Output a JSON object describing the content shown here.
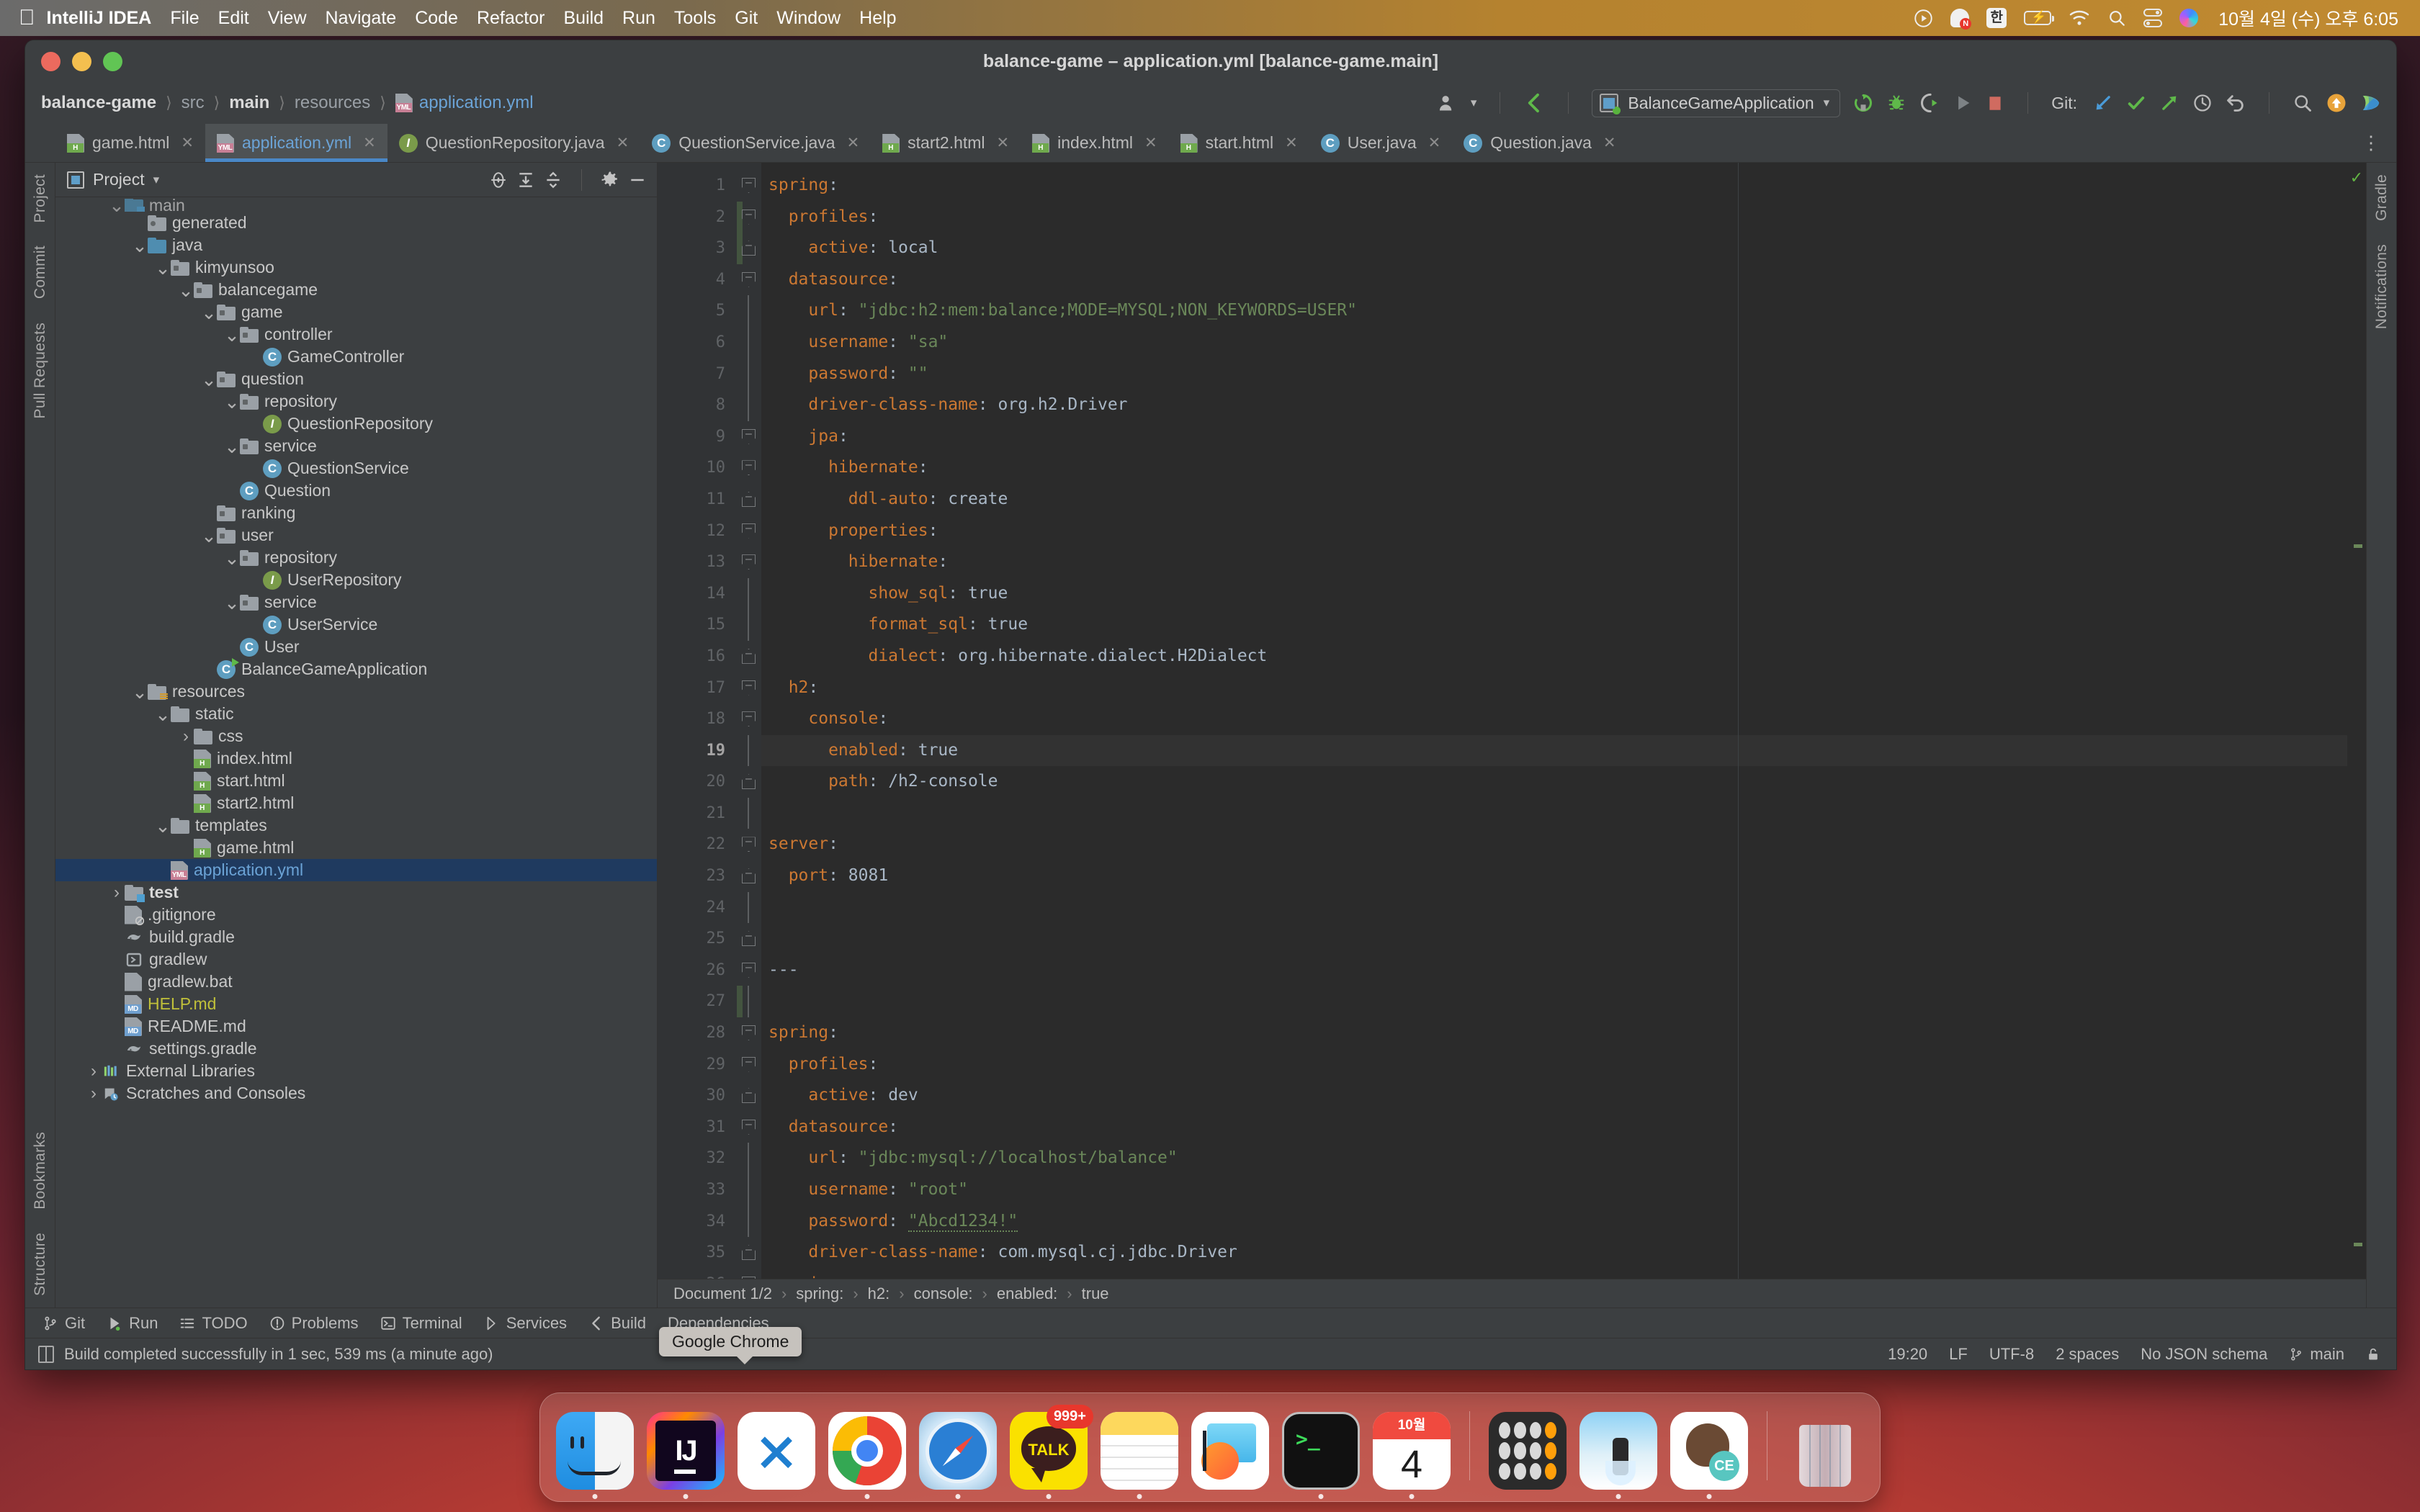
{
  "menubar": {
    "apple_icon": "apple-logo-icon",
    "items": [
      "IntelliJ IDEA",
      "File",
      "Edit",
      "View",
      "Navigate",
      "Code",
      "Refactor",
      "Build",
      "Run",
      "Tools",
      "Git",
      "Window",
      "Help"
    ],
    "tray": {
      "icons": [
        "play-circle-icon",
        "naver-whale-icon",
        "korean-input-icon",
        "battery-charging-icon",
        "wifi-icon",
        "search-icon",
        "control-center-icon",
        "siri-icon"
      ],
      "input_source": "한",
      "clock": "10월 4일 (수) 오후 6:05"
    }
  },
  "window": {
    "title": "balance-game – application.yml [balance-game.main]",
    "traffic_lights": [
      "close-button",
      "minimize-button",
      "zoom-button"
    ]
  },
  "toolbar": {
    "breadcrumb": [
      "balance-game",
      "src",
      "main",
      "resources",
      "application.yml"
    ],
    "run_config": "BalanceGameApplication",
    "git_label": "Git:",
    "icons": [
      "user-avatar-icon",
      "chevron-down-icon",
      "back-arrow-icon",
      "run-config-icon",
      "rerun-icon",
      "debug-icon",
      "coverage-icon",
      "run-icon",
      "stop-icon",
      "update-project-icon",
      "commit-icon",
      "push-icon",
      "history-icon",
      "rollback-icon",
      "search-everywhere-icon",
      "upload-icon",
      "whale-icon"
    ]
  },
  "tabs": [
    {
      "label": "game.html",
      "type": "html",
      "active": false
    },
    {
      "label": "application.yml",
      "type": "yml",
      "active": true
    },
    {
      "label": "QuestionRepository.java",
      "type": "interface",
      "active": false
    },
    {
      "label": "QuestionService.java",
      "type": "class",
      "active": false
    },
    {
      "label": "start2.html",
      "type": "html",
      "active": false
    },
    {
      "label": "index.html",
      "type": "html",
      "active": false
    },
    {
      "label": "start.html",
      "type": "html",
      "active": false
    },
    {
      "label": "User.java",
      "type": "class",
      "active": false
    },
    {
      "label": "Question.java",
      "type": "class",
      "active": false
    }
  ],
  "left_rail": [
    "Project",
    "Commit",
    "Pull Requests",
    "Bookmarks",
    "Structure"
  ],
  "right_rail": [
    "Gradle",
    "Notifications"
  ],
  "project_panel": {
    "title": "Project",
    "header_icons": [
      "locate-icon",
      "expand-all-icon",
      "collapse-all-icon",
      "settings-gear-icon",
      "hide-icon"
    ],
    "tree": [
      {
        "label": "main",
        "depth": 2,
        "arrow": "down",
        "icon": "folder-blue-badge",
        "partial": true
      },
      {
        "label": "generated",
        "depth": 3,
        "arrow": "none",
        "icon": "folder-generated"
      },
      {
        "label": "java",
        "depth": 3,
        "arrow": "down",
        "icon": "folder-blue"
      },
      {
        "label": "kimyunsoo",
        "depth": 4,
        "arrow": "down",
        "icon": "folder-package"
      },
      {
        "label": "balancegame",
        "depth": 5,
        "arrow": "down",
        "icon": "folder-package"
      },
      {
        "label": "game",
        "depth": 6,
        "arrow": "down",
        "icon": "folder-package"
      },
      {
        "label": "controller",
        "depth": 7,
        "arrow": "down",
        "icon": "folder-package"
      },
      {
        "label": "GameController",
        "depth": 8,
        "arrow": "none",
        "icon": "class-icon"
      },
      {
        "label": "question",
        "depth": 6,
        "arrow": "down",
        "icon": "folder-package"
      },
      {
        "label": "repository",
        "depth": 7,
        "arrow": "down",
        "icon": "folder-package"
      },
      {
        "label": "QuestionRepository",
        "depth": 8,
        "arrow": "none",
        "icon": "interface-icon"
      },
      {
        "label": "service",
        "depth": 7,
        "arrow": "down",
        "icon": "folder-package"
      },
      {
        "label": "QuestionService",
        "depth": 8,
        "arrow": "none",
        "icon": "class-icon"
      },
      {
        "label": "Question",
        "depth": 7,
        "arrow": "none",
        "icon": "class-icon"
      },
      {
        "label": "ranking",
        "depth": 6,
        "arrow": "none",
        "icon": "folder-package"
      },
      {
        "label": "user",
        "depth": 6,
        "arrow": "down",
        "icon": "folder-package"
      },
      {
        "label": "repository",
        "depth": 7,
        "arrow": "down",
        "icon": "folder-package"
      },
      {
        "label": "UserRepository",
        "depth": 8,
        "arrow": "none",
        "icon": "interface-icon"
      },
      {
        "label": "service",
        "depth": 7,
        "arrow": "down",
        "icon": "folder-package"
      },
      {
        "label": "UserService",
        "depth": 8,
        "arrow": "none",
        "icon": "class-icon"
      },
      {
        "label": "User",
        "depth": 7,
        "arrow": "none",
        "icon": "class-icon"
      },
      {
        "label": "BalanceGameApplication",
        "depth": 6,
        "arrow": "none",
        "icon": "runnable-class-icon"
      },
      {
        "label": "resources",
        "depth": 3,
        "arrow": "down",
        "icon": "folder-resources"
      },
      {
        "label": "static",
        "depth": 4,
        "arrow": "down",
        "icon": "folder-plain"
      },
      {
        "label": "css",
        "depth": 5,
        "arrow": "right",
        "icon": "folder-plain"
      },
      {
        "label": "index.html",
        "depth": 5,
        "arrow": "none",
        "icon": "html-file-icon"
      },
      {
        "label": "start.html",
        "depth": 5,
        "arrow": "none",
        "icon": "html-file-icon"
      },
      {
        "label": "start2.html",
        "depth": 5,
        "arrow": "none",
        "icon": "html-file-icon"
      },
      {
        "label": "templates",
        "depth": 4,
        "arrow": "down",
        "icon": "folder-plain"
      },
      {
        "label": "game.html",
        "depth": 5,
        "arrow": "none",
        "icon": "html-file-icon"
      },
      {
        "label": "application.yml",
        "depth": 4,
        "arrow": "none",
        "icon": "yml-file-icon",
        "selected": true
      },
      {
        "label": "test",
        "depth": 2,
        "arrow": "right",
        "icon": "folder-test",
        "bold": true
      },
      {
        "label": ".gitignore",
        "depth": 2,
        "arrow": "none",
        "icon": "gitignore-icon"
      },
      {
        "label": "build.gradle",
        "depth": 2,
        "arrow": "none",
        "icon": "gradle-icon"
      },
      {
        "label": "gradlew",
        "depth": 2,
        "arrow": "none",
        "icon": "script-icon"
      },
      {
        "label": "gradlew.bat",
        "depth": 2,
        "arrow": "none",
        "icon": "text-file-icon"
      },
      {
        "label": "HELP.md",
        "depth": 2,
        "arrow": "none",
        "icon": "md-file-icon",
        "color": "help"
      },
      {
        "label": "README.md",
        "depth": 2,
        "arrow": "none",
        "icon": "md-file-icon"
      },
      {
        "label": "settings.gradle",
        "depth": 2,
        "arrow": "none",
        "icon": "gradle-icon"
      },
      {
        "label": "External Libraries",
        "depth": 1,
        "arrow": "right",
        "icon": "libraries-icon"
      },
      {
        "label": "Scratches and Consoles",
        "depth": 1,
        "arrow": "right",
        "icon": "scratches-icon"
      }
    ]
  },
  "editor": {
    "current_line": 19,
    "caret_line": 27,
    "lines": [
      {
        "n": 1,
        "fold": "down",
        "tokens": [
          {
            "t": "spring",
            "c": "k"
          },
          {
            "t": ":",
            "c": "d"
          }
        ]
      },
      {
        "n": 2,
        "fold": "down",
        "green": true,
        "tokens": [
          {
            "t": "  profiles",
            "c": "k"
          },
          {
            "t": ":",
            "c": "d"
          }
        ]
      },
      {
        "n": 3,
        "fold": "up",
        "green": true,
        "tokens": [
          {
            "t": "    active",
            "c": "k"
          },
          {
            "t": ": ",
            "c": "d"
          },
          {
            "t": "local",
            "c": "v"
          }
        ]
      },
      {
        "n": 4,
        "fold": "down",
        "tokens": [
          {
            "t": "  datasource",
            "c": "k"
          },
          {
            "t": ":",
            "c": "d"
          }
        ]
      },
      {
        "n": 5,
        "fold": "",
        "tokens": [
          {
            "t": "    url",
            "c": "k"
          },
          {
            "t": ": ",
            "c": "d"
          },
          {
            "t": "\"jdbc:h2:mem:balance;MODE=MYSQL;NON_KEYWORDS=USER\"",
            "c": "s"
          }
        ]
      },
      {
        "n": 6,
        "fold": "",
        "tokens": [
          {
            "t": "    username",
            "c": "k"
          },
          {
            "t": ": ",
            "c": "d"
          },
          {
            "t": "\"sa\"",
            "c": "s"
          }
        ]
      },
      {
        "n": 7,
        "fold": "",
        "tokens": [
          {
            "t": "    password",
            "c": "k"
          },
          {
            "t": ": ",
            "c": "d"
          },
          {
            "t": "\"\"",
            "c": "s"
          }
        ]
      },
      {
        "n": 8,
        "fold": "",
        "tokens": [
          {
            "t": "    driver-class-name",
            "c": "k"
          },
          {
            "t": ": ",
            "c": "d"
          },
          {
            "t": "org.h2.Driver",
            "c": "v"
          }
        ]
      },
      {
        "n": 9,
        "fold": "down",
        "tokens": [
          {
            "t": "    jpa",
            "c": "k"
          },
          {
            "t": ":",
            "c": "d"
          }
        ]
      },
      {
        "n": 10,
        "fold": "down",
        "tokens": [
          {
            "t": "      hibernate",
            "c": "k"
          },
          {
            "t": ":",
            "c": "d"
          }
        ]
      },
      {
        "n": 11,
        "fold": "up",
        "tokens": [
          {
            "t": "        ddl-auto",
            "c": "k"
          },
          {
            "t": ": ",
            "c": "d"
          },
          {
            "t": "create",
            "c": "v"
          }
        ]
      },
      {
        "n": 12,
        "fold": "down",
        "tokens": [
          {
            "t": "      properties",
            "c": "k"
          },
          {
            "t": ":",
            "c": "d"
          }
        ]
      },
      {
        "n": 13,
        "fold": "down",
        "tokens": [
          {
            "t": "        hibernate",
            "c": "k"
          },
          {
            "t": ":",
            "c": "d"
          }
        ]
      },
      {
        "n": 14,
        "fold": "",
        "tokens": [
          {
            "t": "          show_sql",
            "c": "k"
          },
          {
            "t": ": ",
            "c": "d"
          },
          {
            "t": "true",
            "c": "v"
          }
        ]
      },
      {
        "n": 15,
        "fold": "",
        "tokens": [
          {
            "t": "          format_sql",
            "c": "k"
          },
          {
            "t": ": ",
            "c": "d"
          },
          {
            "t": "true",
            "c": "v"
          }
        ]
      },
      {
        "n": 16,
        "fold": "up",
        "tokens": [
          {
            "t": "          dialect",
            "c": "k"
          },
          {
            "t": ": ",
            "c": "d"
          },
          {
            "t": "org.hibernate.dialect.H2Dialect",
            "c": "v"
          }
        ]
      },
      {
        "n": 17,
        "fold": "down",
        "tokens": [
          {
            "t": "  h2",
            "c": "k"
          },
          {
            "t": ":",
            "c": "d"
          }
        ]
      },
      {
        "n": 18,
        "fold": "down",
        "tokens": [
          {
            "t": "    console",
            "c": "k"
          },
          {
            "t": ":",
            "c": "d"
          }
        ]
      },
      {
        "n": 19,
        "fold": "",
        "current": true,
        "tokens": [
          {
            "t": "      enabled",
            "c": "k"
          },
          {
            "t": ": ",
            "c": "d"
          },
          {
            "t": "true",
            "c": "v"
          }
        ]
      },
      {
        "n": 20,
        "fold": "up",
        "tokens": [
          {
            "t": "      path",
            "c": "k"
          },
          {
            "t": ": ",
            "c": "d"
          },
          {
            "t": "/h2-console",
            "c": "v"
          }
        ]
      },
      {
        "n": 21,
        "fold": "",
        "tokens": []
      },
      {
        "n": 22,
        "fold": "down",
        "tokens": [
          {
            "t": "server",
            "c": "k"
          },
          {
            "t": ":",
            "c": "d"
          }
        ]
      },
      {
        "n": 23,
        "fold": "up",
        "tokens": [
          {
            "t": "  port",
            "c": "k"
          },
          {
            "t": ": ",
            "c": "d"
          },
          {
            "t": "8081",
            "c": "v"
          }
        ]
      },
      {
        "n": 24,
        "fold": "",
        "tokens": []
      },
      {
        "n": 25,
        "fold": "up",
        "tokens": []
      },
      {
        "n": 26,
        "fold": "down",
        "tokens": [
          {
            "t": "---",
            "c": "d"
          }
        ]
      },
      {
        "n": 27,
        "fold": "",
        "green": true,
        "caret": true,
        "tokens": []
      },
      {
        "n": 28,
        "fold": "down",
        "tokens": [
          {
            "t": "spring",
            "c": "k"
          },
          {
            "t": ":",
            "c": "d"
          }
        ]
      },
      {
        "n": 29,
        "fold": "down",
        "tokens": [
          {
            "t": "  profiles",
            "c": "k"
          },
          {
            "t": ":",
            "c": "d"
          }
        ]
      },
      {
        "n": 30,
        "fold": "up",
        "tokens": [
          {
            "t": "    active",
            "c": "k"
          },
          {
            "t": ": ",
            "c": "d"
          },
          {
            "t": "dev",
            "c": "v"
          }
        ]
      },
      {
        "n": 31,
        "fold": "down",
        "tokens": [
          {
            "t": "  datasource",
            "c": "k"
          },
          {
            "t": ":",
            "c": "d"
          }
        ]
      },
      {
        "n": 32,
        "fold": "",
        "tokens": [
          {
            "t": "    url",
            "c": "k"
          },
          {
            "t": ": ",
            "c": "d"
          },
          {
            "t": "\"jdbc:mysql://localhost/balance\"",
            "c": "s"
          }
        ]
      },
      {
        "n": 33,
        "fold": "",
        "tokens": [
          {
            "t": "    username",
            "c": "k"
          },
          {
            "t": ": ",
            "c": "d"
          },
          {
            "t": "\"root\"",
            "c": "s"
          }
        ]
      },
      {
        "n": 34,
        "fold": "",
        "tokens": [
          {
            "t": "    password",
            "c": "k"
          },
          {
            "t": ": ",
            "c": "d"
          },
          {
            "t": "\"Abcd1234!\"",
            "c": "s"
          }
        ]
      },
      {
        "n": 35,
        "fold": "up",
        "tokens": [
          {
            "t": "    driver-class-name",
            "c": "k"
          },
          {
            "t": ": ",
            "c": "d"
          },
          {
            "t": "com.mysql.cj.jdbc.Driver",
            "c": "v"
          }
        ]
      },
      {
        "n": 36,
        "fold": "down",
        "clipped": true,
        "tokens": [
          {
            "t": "    jpa",
            "c": "k"
          },
          {
            "t": ":",
            "c": "d"
          }
        ]
      }
    ]
  },
  "editor_breadcrumb": [
    "Document 1/2",
    "spring:",
    "h2:",
    "console:",
    "enabled:",
    "true"
  ],
  "tool_windows": [
    {
      "label": "Git",
      "icon": "git-branch-icon"
    },
    {
      "label": "Run",
      "icon": "run-icon"
    },
    {
      "label": "TODO",
      "icon": "todo-list-icon"
    },
    {
      "label": "Problems",
      "icon": "problems-icon"
    },
    {
      "label": "Terminal",
      "icon": "terminal-icon"
    },
    {
      "label": "Services",
      "icon": "services-icon"
    },
    {
      "label": "Build",
      "icon": "build-icon"
    },
    {
      "label": "Dependencies",
      "icon": "dependencies-icon"
    }
  ],
  "tooltip": "Google Chrome",
  "statusbar": {
    "message": "Build completed successfully in 1 sec, 539 ms (a minute ago)",
    "caret_position": "19:20",
    "line_separator": "LF",
    "encoding": "UTF-8",
    "indent": "2 spaces",
    "schema": "No JSON schema",
    "branch": "main",
    "icons": [
      "event-log-icon",
      "git-branch-icon",
      "lock-icon"
    ]
  },
  "dock": {
    "apps": [
      {
        "name": "Finder",
        "icon": "finder-icon",
        "running": true
      },
      {
        "name": "IntelliJ IDEA",
        "icon": "intellij-idea-icon",
        "running": true
      },
      {
        "name": "Visual Studio Code",
        "icon": "vscode-icon",
        "running": false
      },
      {
        "name": "Google Chrome",
        "icon": "chrome-icon",
        "running": true
      },
      {
        "name": "Safari",
        "icon": "safari-icon",
        "running": true
      },
      {
        "name": "KakaoTalk",
        "icon": "kakaotalk-icon",
        "badge": "999+",
        "running": true
      },
      {
        "name": "Notes",
        "icon": "notes-icon",
        "running": true
      },
      {
        "name": "Stocks",
        "icon": "stocks-icon",
        "running": false
      },
      {
        "name": "Terminal",
        "icon": "terminal-icon",
        "running": true
      },
      {
        "name": "Calendar",
        "icon": "calendar-icon",
        "day": "4",
        "month": "10월",
        "running": true
      }
    ],
    "apps2": [
      {
        "name": "Calculator",
        "icon": "calculator-icon",
        "running": false
      },
      {
        "name": "Preview",
        "icon": "preview-icon",
        "running": true
      },
      {
        "name": "Bear",
        "icon": "bear-ce-icon",
        "running": true
      }
    ],
    "trash": {
      "name": "Trash",
      "icon": "trash-icon"
    }
  }
}
